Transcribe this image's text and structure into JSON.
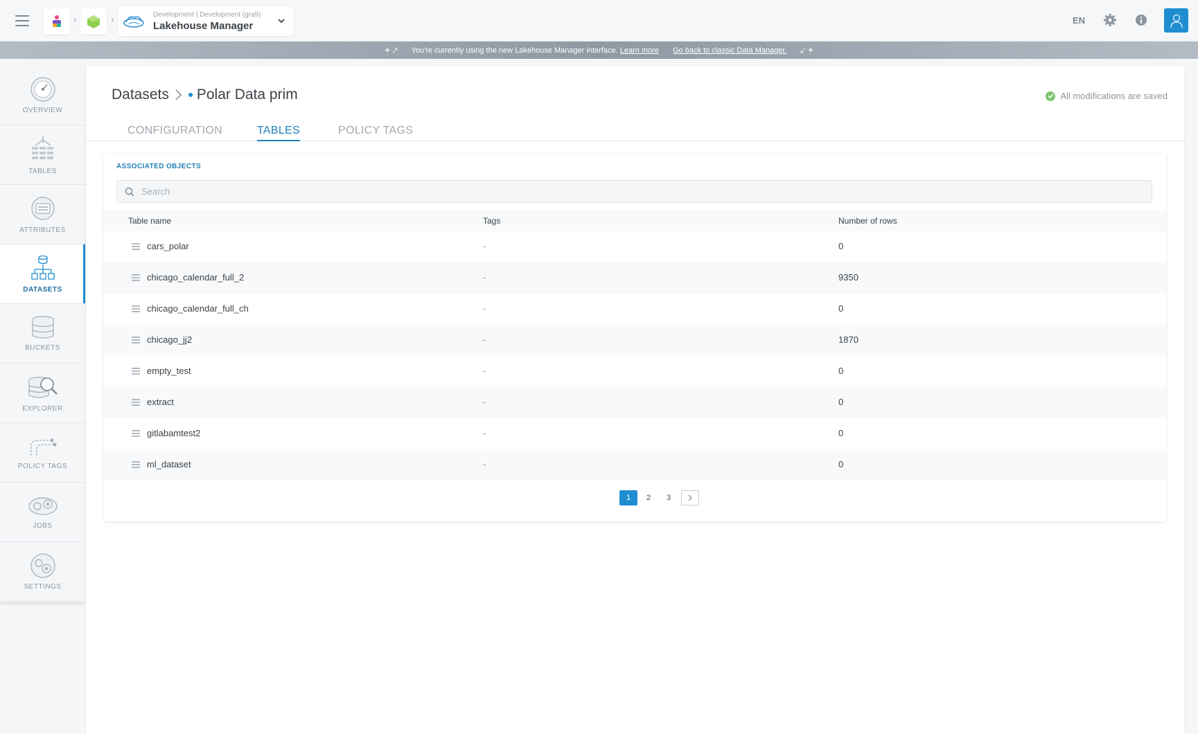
{
  "topbar": {
    "app_context": "Development | Development (gra9)",
    "app_title": "Lakehouse Manager",
    "lang": "EN"
  },
  "banner": {
    "message": "You're currently using the new Lakehouse Manager interface.",
    "learn_more": "Learn more",
    "go_back": "Go back to classic Data Manager."
  },
  "sidebar": {
    "items": [
      {
        "label": "OVERVIEW",
        "icon": "gauge-icon"
      },
      {
        "label": "TABLES",
        "icon": "tables-icon"
      },
      {
        "label": "ATTRIBUTES",
        "icon": "attributes-icon"
      },
      {
        "label": "DATASETS",
        "icon": "datasets-icon",
        "active": true
      },
      {
        "label": "BUCKETS",
        "icon": "bucket-icon"
      },
      {
        "label": "EXPLORER",
        "icon": "explorer-icon"
      },
      {
        "label": "POLICY TAGS",
        "icon": "policy-tags-icon"
      },
      {
        "label": "JOBS",
        "icon": "jobs-icon"
      },
      {
        "label": "SETTINGS",
        "icon": "settings-icon"
      }
    ]
  },
  "header": {
    "breadcrumb_root": "Datasets",
    "breadcrumb_current": "Polar Data prim",
    "saved_status": "All modifications are saved"
  },
  "tabs": [
    {
      "label": "CONFIGURATION"
    },
    {
      "label": "TABLES",
      "active": true
    },
    {
      "label": "POLICY TAGS"
    }
  ],
  "card": {
    "title": "ASSOCIATED OBJECTS",
    "search_placeholder": "Search"
  },
  "table": {
    "headers": [
      "Table name",
      "Tags",
      "Number of rows"
    ],
    "rows": [
      {
        "name": "cars_polar",
        "tags": "-",
        "rows": "0"
      },
      {
        "name": "chicago_calendar_full_2",
        "tags": "-",
        "rows": "9350"
      },
      {
        "name": "chicago_calendar_full_ch",
        "tags": "-",
        "rows": "0"
      },
      {
        "name": "chicago_jj2",
        "tags": "-",
        "rows": "1870"
      },
      {
        "name": "empty_test",
        "tags": "-",
        "rows": "0"
      },
      {
        "name": "extract",
        "tags": "-",
        "rows": "0"
      },
      {
        "name": "gitlabamtest2",
        "tags": "-",
        "rows": "0"
      },
      {
        "name": "ml_dataset",
        "tags": "-",
        "rows": "0"
      }
    ]
  },
  "pagination": {
    "pages": [
      "1",
      "2",
      "3"
    ],
    "current": "1"
  },
  "colors": {
    "accent": "#1f8ed0",
    "success": "#7cc46d"
  }
}
